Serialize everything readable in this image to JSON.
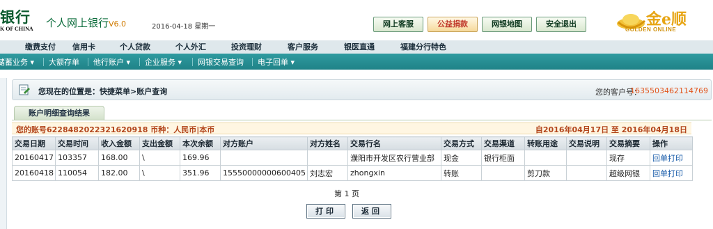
{
  "header": {
    "bank_logo_cn": "银行",
    "bank_logo_en": "K OF CHINA",
    "app_title": "个人网上银行",
    "app_version": "V6.0",
    "date": "2016-04-18 星期一",
    "buttons": {
      "customer_service": "网上客服",
      "charity": "公益捐款",
      "branch_map": "网银地图",
      "logout": "安全退出"
    },
    "golden_logo_cn": "金e顺",
    "golden_logo_en": "GOLDEN ONLINE"
  },
  "nav_main": [
    "缴费支付",
    "信用卡",
    "个人贷款",
    "个人外汇",
    "投资理财",
    "客户服务",
    "银医直通",
    "福建分行特色"
  ],
  "nav_sub": [
    "储蓄业务 ▾",
    "大额存单",
    "他行账户 ▾",
    "企业服务 ▾",
    "网银交易查询",
    "电子回单 ▾"
  ],
  "location": {
    "text": "您现在的位置是：快捷菜单>账户查询",
    "customer_label": "您的客户号：",
    "customer_no": "1635503462114769"
  },
  "tab_label": "账户明细查询结果",
  "account": {
    "info": "您的账号6228482022321620918 币种：人民币|本币",
    "period": "自2016年04月17日  至  2016年04月18日"
  },
  "table": {
    "headers": [
      "交易日期",
      "交易时间",
      "收入金额",
      "支出金额",
      "本次余额",
      "对方账户",
      "对方姓名",
      "交易行名",
      "交易方式",
      "交易渠道",
      "转账用途",
      "交易说明",
      "交易摘要",
      "操作"
    ],
    "rows": [
      [
        "20160417",
        "103357",
        "168.00",
        "\\",
        "169.96",
        "",
        "",
        "濮阳市开发区农行营业部",
        "现金",
        "银行柜面",
        "",
        "",
        "现存",
        "回单打印"
      ],
      [
        "20160418",
        "110054",
        "182.00",
        "\\",
        "351.96",
        "15550000000600405",
        "刘志宏",
        "zhongxin",
        "转账",
        "",
        "剪刀款",
        "",
        "超级网银",
        "回单打印"
      ]
    ]
  },
  "pagination": "第 1 页",
  "actions": {
    "print": "打印",
    "back": "返回"
  },
  "colors": {
    "accent_orange": "#e2541b",
    "nav_teal": "#1f8287",
    "brand_green": "#0a6b3a"
  }
}
